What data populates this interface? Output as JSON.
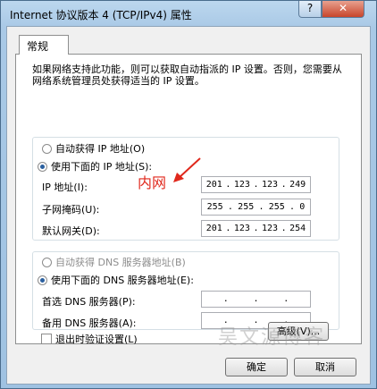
{
  "window": {
    "title": "Internet 协议版本 4 (TCP/IPv4) 属性",
    "help_glyph": "?",
    "close_glyph": "✕"
  },
  "tab": {
    "label": "常规"
  },
  "description": "如果网络支持此功能，则可以获取自动指派的 IP 设置。否则，您需要从网络系统管理员处获得适当的 IP 设置。",
  "ip_section": {
    "auto_label": "自动获得 IP 地址(O)",
    "manual_label": "使用下面的 IP 地址(S):",
    "selected": "manual",
    "fields": [
      {
        "label": "IP 地址(I):",
        "octets": [
          "201",
          "123",
          "123",
          "249"
        ]
      },
      {
        "label": "子网掩码(U):",
        "octets": [
          "255",
          "255",
          "255",
          "0"
        ]
      },
      {
        "label": "默认网关(D):",
        "octets": [
          "201",
          "123",
          "123",
          "254"
        ]
      }
    ]
  },
  "dns_section": {
    "auto_label": "自动获得 DNS 服务器地址(B)",
    "manual_label": "使用下面的 DNS 服务器地址(E):",
    "selected": "manual",
    "fields": [
      {
        "label": "首选 DNS 服务器(P):",
        "octets": [
          "",
          "",
          "",
          ""
        ]
      },
      {
        "label": "备用 DNS 服务器(A):",
        "octets": [
          "",
          "",
          "",
          ""
        ]
      }
    ]
  },
  "validate_label": "退出时验证设置(L)",
  "advanced_button": "高级(V)...",
  "ok_button": "确定",
  "cancel_button": "取消",
  "annotation": "内网",
  "watermark": "吴文源博客",
  "colors": {
    "annotation": "#e0281c",
    "selected_radio": "#2a5f9f"
  }
}
